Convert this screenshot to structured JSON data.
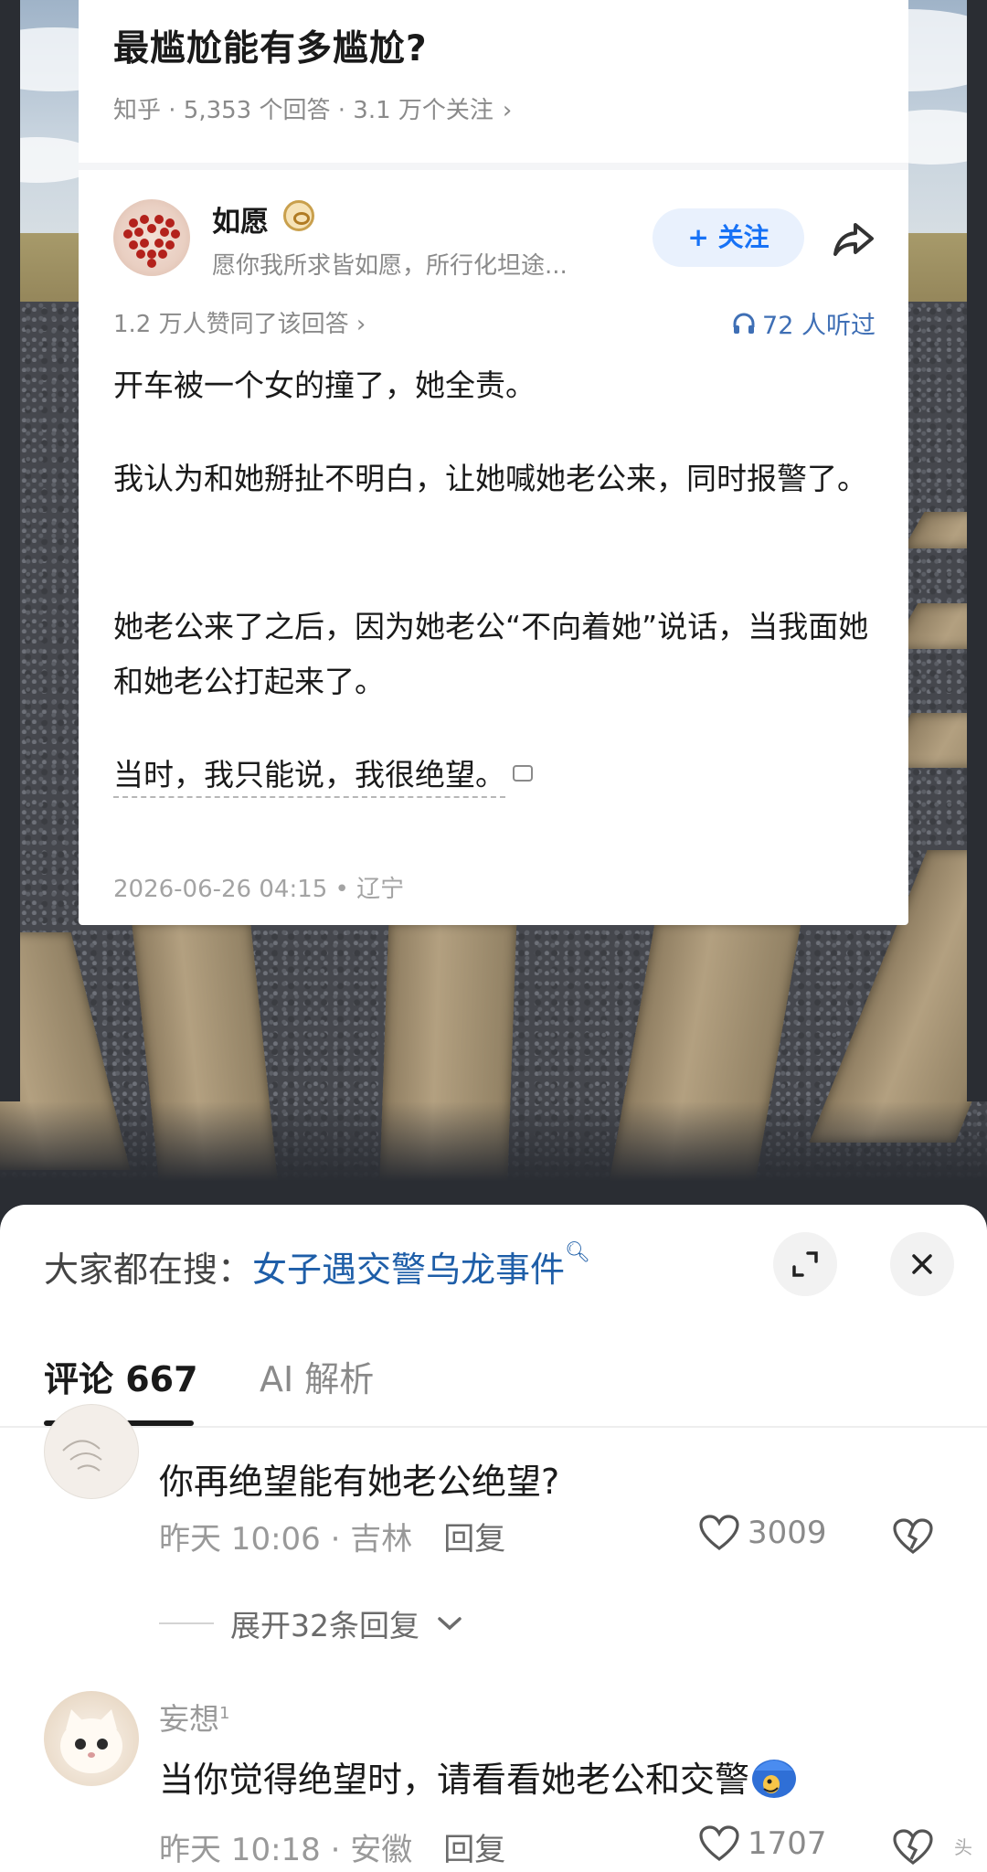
{
  "question": {
    "title": "最尴尬能有多尴尬?",
    "meta": "知乎 · 5,353 个回答 · 3.1 万个关注",
    "meta_chevron": "›"
  },
  "author": {
    "name": "如愿",
    "bio": "愿你我所求皆如愿，所行化坦途...",
    "follow_label": "+ 关注"
  },
  "answer": {
    "votes": "1.2 万人赞同了该回答 ›",
    "listens": "72 人听过",
    "paragraphs": [
      "开车被一个女的撞了，她全责。",
      "我认为和她掰扯不明白，让她喊她老公来，同时报警了。",
      "她老公来了之后，因为她老公“不向着她”说话，当我面她和她老公打起来了。",
      "当时，我只能说，我很绝望。"
    ],
    "time_location": "2026-06-26 04:15 • 辽宁"
  },
  "sheet": {
    "search_prefix": "大家都在搜：",
    "search_term": "女子遇交警乌龙事件",
    "tabs": {
      "comments": "评论 667",
      "ai": "AI 解析"
    },
    "comments": [
      {
        "text": "你再绝望能有她老公绝望?",
        "time": "昨天 10:06 · 吉林",
        "reply_label": "回复",
        "likes": "3009",
        "expand_replies": "展开32条回复"
      },
      {
        "name": "妄想",
        "name_sup": "1",
        "text": "当你觉得绝望时，请看看她老公和交警",
        "time": "昨天 10:18 · 安徽",
        "reply_label": "回复",
        "likes": "1707"
      }
    ],
    "watermark": "头"
  },
  "colors": {
    "accent_blue": "#1772f6",
    "search_term": "#1e5ea8",
    "muted": "#8a8a8a"
  },
  "icons": [
    "share-icon",
    "headphones-icon",
    "expand-icon",
    "close-icon",
    "heart-icon",
    "broken-heart-icon",
    "chevron-down-icon",
    "search-icon"
  ]
}
